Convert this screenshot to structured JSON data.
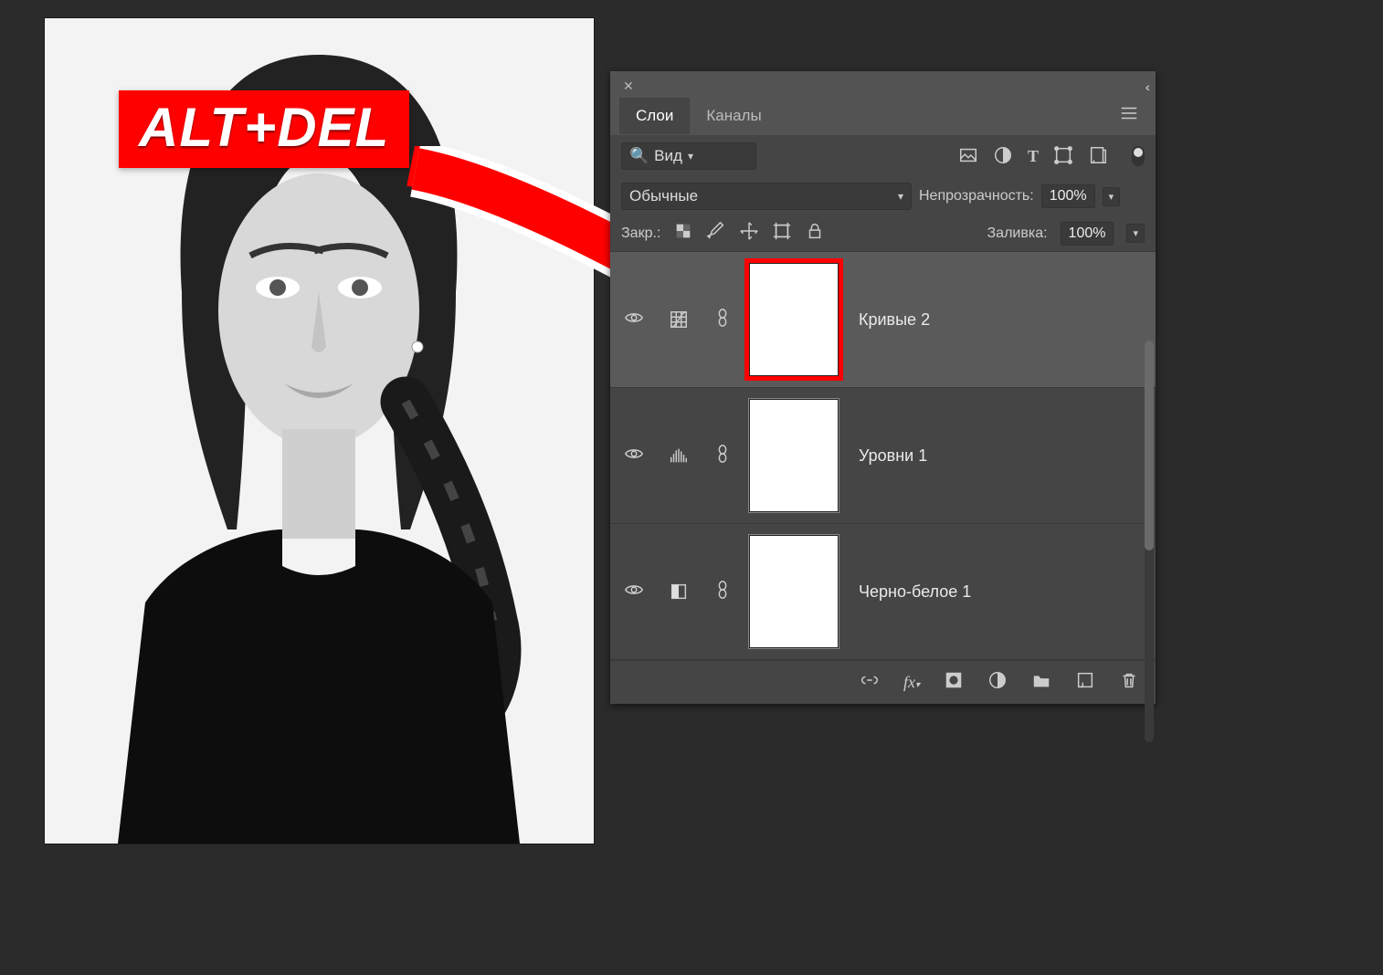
{
  "badge_text": "ALT+DEL",
  "panel": {
    "tabs": {
      "layers": "Слои",
      "channels": "Каналы"
    },
    "active_tab": "layers",
    "search": {
      "label": "Вид"
    },
    "blend_mode": {
      "label": "Обычные"
    },
    "opacity": {
      "label": "Непрозрачность:",
      "value": "100%"
    },
    "lock_label": "Закр.:",
    "fill": {
      "label": "Заливка:",
      "value": "100%"
    },
    "layers": [
      {
        "name": "Кривые 2",
        "selected": true,
        "highlighted_mask": true,
        "adj_type": "curves"
      },
      {
        "name": "Уровни 1",
        "selected": false,
        "highlighted_mask": false,
        "adj_type": "levels"
      },
      {
        "name": "Черно-белое 1",
        "selected": false,
        "highlighted_mask": false,
        "adj_type": "bw"
      }
    ]
  },
  "annotation_arrow": {
    "color": "#ff0000",
    "stroke_width": 30
  }
}
